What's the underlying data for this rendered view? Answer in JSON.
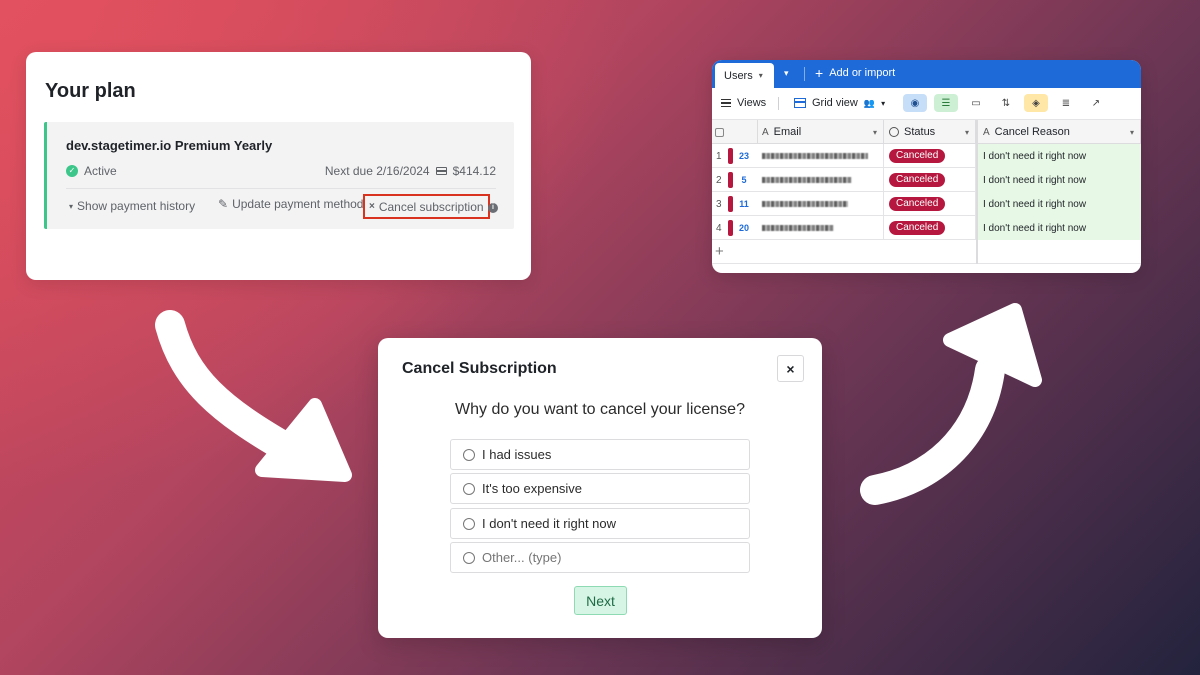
{
  "plan_card": {
    "title": "Your plan",
    "plan_name": "dev.stagetimer.io Premium Yearly",
    "status": "Active",
    "next_due": "Next due 2/16/2024",
    "amount": "$414.12",
    "actions": {
      "history": "Show payment history",
      "update": "Update payment method",
      "cancel": "Cancel subscription"
    }
  },
  "grid": {
    "tab": "Users",
    "add_import": "Add or import",
    "views": "Views",
    "grid_view": "Grid view",
    "columns": {
      "email": "Email",
      "status": "Status",
      "reason": "Cancel Reason"
    },
    "rows": [
      {
        "num": "1",
        "id": "23",
        "status": "Canceled",
        "reason": "I don't need it right now"
      },
      {
        "num": "2",
        "id": "5",
        "status": "Canceled",
        "reason": "I don't need it right now"
      },
      {
        "num": "3",
        "id": "11",
        "status": "Canceled",
        "reason": "I don't need it right now"
      },
      {
        "num": "4",
        "id": "20",
        "status": "Canceled",
        "reason": "I don't need it right now"
      }
    ],
    "add_row": "+"
  },
  "modal": {
    "title": "Cancel Subscription",
    "close": "×",
    "question": "Why do you want to cancel your license?",
    "options": [
      "I had issues",
      "It's too expensive",
      "I don't need it right now",
      "Other... (type)"
    ],
    "next": "Next"
  },
  "colors": {
    "accent_green": "#3cc68a",
    "highlight_red": "#d9321f",
    "airtable_blue": "#1d6ad8",
    "canceled_red": "#b5173e"
  }
}
